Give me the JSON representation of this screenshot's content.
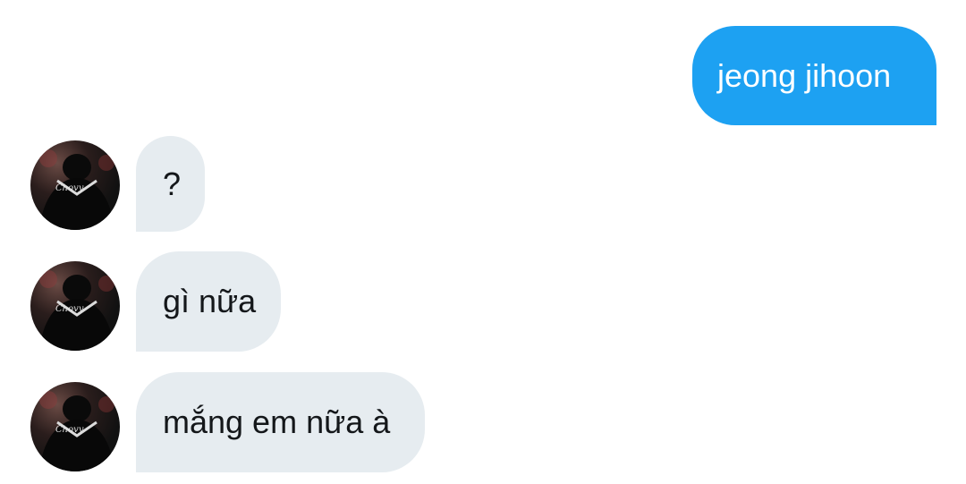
{
  "messages": [
    {
      "direction": "sent",
      "text": "jeong jihoon"
    },
    {
      "direction": "received",
      "text": "?",
      "avatar": "user-avatar-photo"
    },
    {
      "direction": "received",
      "text": "gì nữa",
      "avatar": "user-avatar-photo"
    },
    {
      "direction": "received",
      "text": "mắng em nữa à",
      "avatar": "user-avatar-photo"
    }
  ],
  "colors": {
    "sent_bubble": "#1da1f2",
    "received_bubble": "#e6ecf0",
    "received_text": "#14171a"
  }
}
